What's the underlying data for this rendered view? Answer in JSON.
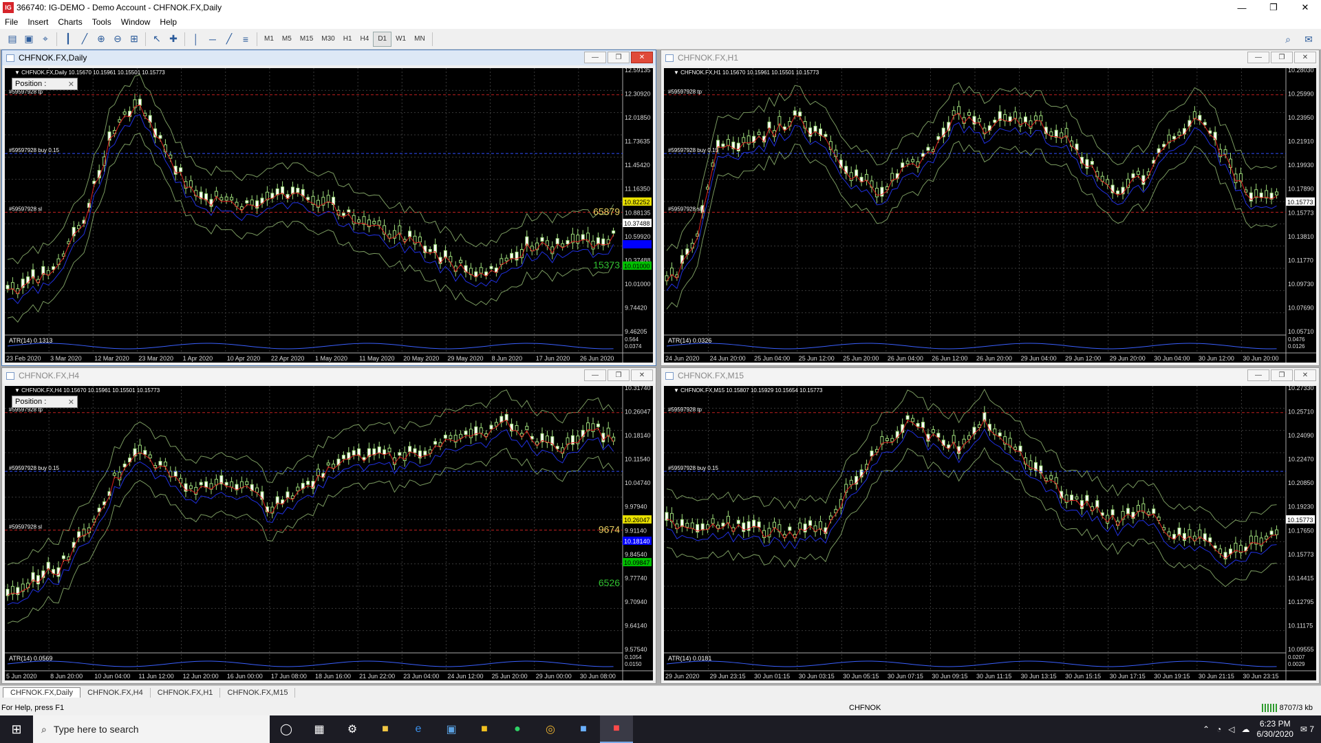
{
  "window": {
    "title": "366740: IG-DEMO - Demo Account - CHFNOK.FX,Daily",
    "app_icon": "IG",
    "controls": [
      "minimize-icon",
      "restore-icon",
      "close-icon"
    ]
  },
  "menu": [
    "File",
    "Insert",
    "Charts",
    "Tools",
    "Window",
    "Help"
  ],
  "toolbar": {
    "timeframes": [
      "M1",
      "M5",
      "M15",
      "M30",
      "H1",
      "H4",
      "D1",
      "W1",
      "MN"
    ],
    "active_timeframe": "D1"
  },
  "charts": [
    {
      "key": "daily",
      "title": "CHFNOK.FX,Daily",
      "header": "CHFNOK.FX,Daily  10.15670 10.15961 10.15501 10.15773",
      "active": true,
      "position_label": "Position :",
      "prices": [
        "12.59135",
        "12.30920",
        "12.01850",
        "11.73635",
        "11.45420",
        "11.16350",
        "10.88135",
        "10.59920",
        "10.37488",
        "10.01000",
        "9.74420",
        "9.46205"
      ],
      "price_tags": [
        {
          "text": "10.82252",
          "bg": "#e8e000",
          "fg": "#000000"
        },
        {
          "text": "10.37488",
          "bg": "#ffffff",
          "fg": "#000000"
        },
        {
          "text": "",
          "bg": "#0000ff",
          "fg": "#ffffff"
        },
        {
          "text": "10.01000",
          "bg": "#00c000",
          "fg": "#000000"
        }
      ],
      "big_labels": [
        "65879",
        "15373"
      ],
      "order_labels": [
        "#59597928 tp",
        "#59597928 buy 0.15",
        "#59597928 sl"
      ],
      "atr": "ATR(14) 0.1313",
      "atr_scale": [
        "0.564",
        "0.0374"
      ],
      "dates": [
        "23 Feb 2020",
        "3 Mar 2020",
        "12 Mar 2020",
        "23 Mar 2020",
        "1 Apr 2020",
        "10 Apr 2020",
        "22 Apr 2020",
        "1 May 2020",
        "11 May 2020",
        "20 May 2020",
        "29 May 2020",
        "8 Jun 2020",
        "17 Jun 2020",
        "26 Jun 2020"
      ]
    },
    {
      "key": "h1",
      "title": "CHFNOK.FX,H1",
      "header": "CHFNOK.FX,H1  10.15670 10.15961 10.15501 10.15773",
      "active": false,
      "position_label": "",
      "prices": [
        "10.28030",
        "10.25990",
        "10.23950",
        "10.21910",
        "10.19930",
        "10.17890",
        "10.15773",
        "10.13810",
        "10.11770",
        "10.09730",
        "10.07690",
        "10.05710"
      ],
      "price_tags": [
        {
          "text": "10.15773",
          "bg": "#ffffff",
          "fg": "#000000"
        }
      ],
      "big_labels": [],
      "order_labels": [
        "#59597928 tp",
        "#59597928 buy 0.15",
        "#59597928 sl"
      ],
      "atr": "ATR(14) 0.0326",
      "atr_scale": [
        "0.0476",
        "0.0126"
      ],
      "dates": [
        "24 Jun 2020",
        "24 Jun 20:00",
        "25 Jun 04:00",
        "25 Jun 12:00",
        "25 Jun 20:00",
        "26 Jun 04:00",
        "26 Jun 12:00",
        "26 Jun 20:00",
        "29 Jun 04:00",
        "29 Jun 12:00",
        "29 Jun 20:00",
        "30 Jun 04:00",
        "30 Jun 12:00",
        "30 Jun 20:00"
      ]
    },
    {
      "key": "h4",
      "title": "CHFNOK.FX,H4",
      "header": "CHFNOK.FX,H4  10.15670 10.15961 10.15501 10.15773",
      "active": false,
      "position_label": "Position :",
      "prices": [
        "10.31740",
        "10.26047",
        "10.18140",
        "10.11540",
        "10.04740",
        "9.97940",
        "9.91140",
        "9.84540",
        "9.77740",
        "9.70940",
        "9.64140",
        "9.57540"
      ],
      "price_tags": [
        {
          "text": "10.26047",
          "bg": "#e8e000",
          "fg": "#000000"
        },
        {
          "text": "10.18140",
          "bg": "#0000ff",
          "fg": "#ffffff"
        },
        {
          "text": "10.09847",
          "bg": "#00c000",
          "fg": "#000000"
        }
      ],
      "big_labels": [
        "9674",
        "6526"
      ],
      "order_labels": [
        "#59597928 tp",
        "#59597928 buy 0.15",
        "#59597928 sl"
      ],
      "atr": "ATR(14) 0.0569",
      "atr_scale": [
        "0.1054",
        "0.0150"
      ],
      "dates": [
        "5 Jun 2020",
        "8 Jun 20:00",
        "10 Jun 04:00",
        "11 Jun 12:00",
        "12 Jun 20:00",
        "16 Jun 00:00",
        "17 Jun 08:00",
        "18 Jun 16:00",
        "21 Jun 22:00",
        "23 Jun 04:00",
        "24 Jun 12:00",
        "25 Jun 20:00",
        "29 Jun 00:00",
        "30 Jun 08:00"
      ]
    },
    {
      "key": "m15",
      "title": "CHFNOK.FX,M15",
      "header": "CHFNOK.FX,M15  10.15807 10.15929 10.15654 10.15773",
      "active": false,
      "position_label": "",
      "prices": [
        "10.27330",
        "10.25710",
        "10.24090",
        "10.22470",
        "10.20850",
        "10.19230",
        "10.17650",
        "10.15773",
        "10.14415",
        "10.12795",
        "10.11175",
        "10.09555"
      ],
      "price_tags": [
        {
          "text": "10.15773",
          "bg": "#ffffff",
          "fg": "#000000"
        }
      ],
      "big_labels": [],
      "order_labels": [
        "#59597928 tp",
        "#59597928 buy 0.15"
      ],
      "atr": "ATR(14) 0.0181",
      "atr_scale": [
        "0.0207",
        "0.0029"
      ],
      "dates": [
        "29 Jun 2020",
        "29 Jun 23:15",
        "30 Jun 01:15",
        "30 Jun 03:15",
        "30 Jun 05:15",
        "30 Jun 07:15",
        "30 Jun 09:15",
        "30 Jun 11:15",
        "30 Jun 13:15",
        "30 Jun 15:15",
        "30 Jun 17:15",
        "30 Jun 19:15",
        "30 Jun 21:15",
        "30 Jun 23:15"
      ]
    }
  ],
  "tabs": [
    "CHFNOK.FX,Daily",
    "CHFNOK.FX,H4",
    "CHFNOK.FX,H1",
    "CHFNOK.FX,M15"
  ],
  "active_tab": "CHFNOK.FX,Daily",
  "status": {
    "help": "For Help, press F1",
    "symbol": "CHFNOK",
    "traffic": "8707/3 kb"
  },
  "taskbar": {
    "search_placeholder": "Type here to search",
    "time": "6:23 PM",
    "date": "6/30/2020",
    "notifications": "7"
  }
}
